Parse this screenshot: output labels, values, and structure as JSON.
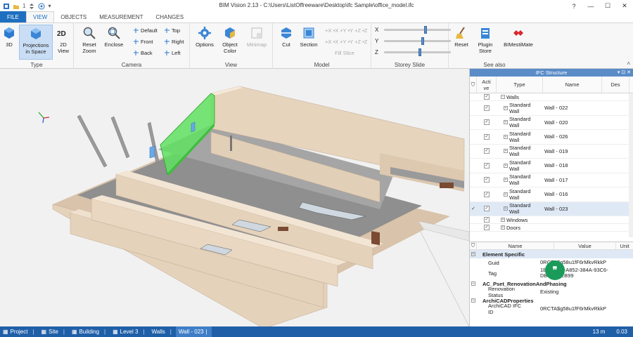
{
  "window": {
    "title": "BIM Vision 2.13 - C:\\Users\\ListOffreeware\\Desktop\\ifc Sample\\office_model.ifc",
    "qa_number": "1"
  },
  "tabs": [
    "FILE",
    "VIEW",
    "OBJECTS",
    "MEASUREMENT",
    "CHANGES"
  ],
  "ribbon": {
    "type_group": {
      "label": "Type",
      "btn_3d": "3D",
      "btn_proj_1": "Projections",
      "btn_proj_2": "in Space",
      "btn_2d_1": "2D",
      "btn_2d_2": "View"
    },
    "camera_group": {
      "label": "Camera",
      "reset_zoom_1": "Reset",
      "reset_zoom_2": "Zoom",
      "enclose": "Enclose",
      "default": "Default",
      "front": "Front",
      "back": "Back",
      "top": "Top",
      "right": "Right",
      "left": "Left"
    },
    "view_group": {
      "label": "View",
      "options": "Options",
      "object_color_1": "Object",
      "object_color_2": "Color",
      "minimap": "Minimap"
    },
    "model_group": {
      "label": "Model",
      "cut": "Cut",
      "section": "Section",
      "axes_1": "+X •X +Y •Y +Z •Z",
      "axes_2": "+X •X +Y •Y +Z •Z",
      "fill_slice": "Fill Slice"
    },
    "storey_group": {
      "label": "Storey Slide",
      "x": "X",
      "y": "Y",
      "z": "Z",
      "x_pos": 0.6,
      "y_pos": 0.55,
      "z_pos": 0.52
    },
    "seealso_group": {
      "label": "See also",
      "reset": "Reset",
      "plugin_store_1": "Plugin",
      "plugin_store_2": "Store",
      "bimestimate": "BIMestiMate"
    }
  },
  "ifc_panel": {
    "title": "IFC Structure",
    "headers": {
      "active_1": "Acti",
      "active_2": "ve",
      "type": "Type",
      "name": "Name",
      "desc": "Des"
    },
    "walls_label": "Walls",
    "rows": [
      {
        "type_1": "Standard",
        "type_2": "Wall",
        "name": "Wall - 022"
      },
      {
        "type_1": "Standard",
        "type_2": "Wall",
        "name": "Wall - 020"
      },
      {
        "type_1": "Standard",
        "type_2": "Wall",
        "name": "Wall - 026"
      },
      {
        "type_1": "Standard",
        "type_2": "Wall",
        "name": "Wall - 019"
      },
      {
        "type_1": "Standard",
        "type_2": "Wall",
        "name": "Wall - 018"
      },
      {
        "type_1": "Standard",
        "type_2": "Wall",
        "name": "Wall - 017"
      },
      {
        "type_1": "Standard",
        "type_2": "Wall",
        "name": "Wall - 016"
      },
      {
        "type_1": "Standard",
        "type_2": "Wall",
        "name": "Wall - 023"
      }
    ],
    "windows_label": "Windows",
    "doors_label": "Doors"
  },
  "props_panel": {
    "headers": {
      "name": "Name",
      "value": "Value",
      "unit": "Unit"
    },
    "element_specific": "Element Specific",
    "guid_key": "Guid",
    "guid_val": "0RCTA$g58u1fF6rMkvRkkP",
    "tag_key": "Tag",
    "tag_val_1": "1B6CDBF-A852-384A-93C6-",
    "tag_val_2": "DB7D1EEB99",
    "pset": "AC_Pset_RenovationAndPhasing",
    "renovation_key": "Renovation Status",
    "renovation_val": "Existing",
    "archicad": "ArchiCADProperties",
    "ifcid_key": "ArchiCAD IFC ID",
    "ifcid_val": "0RCTA$g58u1fF6rMkvRkkP"
  },
  "status": {
    "crumbs": [
      "Project",
      "Site",
      "Building",
      "Level 3",
      "Walls",
      "Wall - 023"
    ],
    "distance": "13 m",
    "time": "0.03"
  },
  "colors": {
    "accent": "#1e6fbf",
    "selection_green": "#5fe05f",
    "wall": "#e5d2bb",
    "floor": "#9a9a9a"
  }
}
